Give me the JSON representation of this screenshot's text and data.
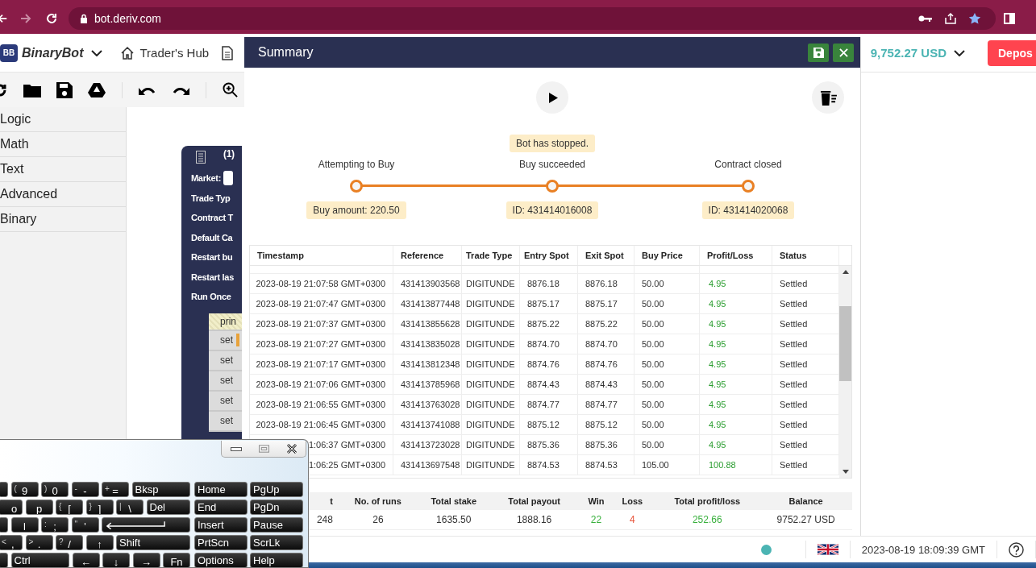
{
  "browser": {
    "url": "bot.deriv.com"
  },
  "header": {
    "logo": "BB",
    "app_name": "BinaryBot",
    "hub_link": "Trader's Hub",
    "balance": "9,752.27 USD",
    "deposit_button": "Depos"
  },
  "toolbox": [
    "Logic",
    "Math",
    "Text",
    "Advanced",
    "Binary"
  ],
  "workspace_block": {
    "count": "(1)",
    "fields": [
      "Market:",
      "Trade Typ",
      "Contract T",
      "Default Ca",
      "Restart bu",
      "Restart las",
      "Run Once"
    ],
    "statements": [
      {
        "kind": "print",
        "text": "prin",
        "has_variable": false
      },
      {
        "kind": "set",
        "text": "set",
        "has_variable": true
      },
      {
        "kind": "set",
        "text": "set",
        "has_variable": false
      },
      {
        "kind": "set",
        "text": "set",
        "has_variable": false
      },
      {
        "kind": "set",
        "text": "set",
        "has_variable": false
      },
      {
        "kind": "set",
        "text": "set",
        "has_variable": false
      }
    ]
  },
  "summary": {
    "title": "Summary",
    "status_message": "Bot has stopped.",
    "steps": [
      {
        "label": "Attempting to Buy",
        "info": "Buy amount: 220.50"
      },
      {
        "label": "Buy succeeded",
        "info": "ID: 431414016008"
      },
      {
        "label": "Contract closed",
        "info": "ID: 431414020068"
      }
    ],
    "table": {
      "columns": [
        "Timestamp",
        "Reference",
        "Trade Type",
        "Entry Spot",
        "Exit Spot",
        "Buy Price",
        "Profit/Loss",
        "Status"
      ],
      "rows": [
        [
          "2023-08-19 21:07:58 GMT+0300",
          "431413903568",
          "DIGITUNDE",
          "8876.18",
          "8876.18",
          "50.00",
          "4.95",
          "Settled"
        ],
        [
          "2023-08-19 21:07:47 GMT+0300",
          "431413877448",
          "DIGITUNDE",
          "8875.17",
          "8875.17",
          "50.00",
          "4.95",
          "Settled"
        ],
        [
          "2023-08-19 21:07:37 GMT+0300",
          "431413855628",
          "DIGITUNDE",
          "8875.22",
          "8875.22",
          "50.00",
          "4.95",
          "Settled"
        ],
        [
          "2023-08-19 21:07:27 GMT+0300",
          "431413835028",
          "DIGITUNDE",
          "8874.70",
          "8874.70",
          "50.00",
          "4.95",
          "Settled"
        ],
        [
          "2023-08-19 21:07:17 GMT+0300",
          "431413812348",
          "DIGITUNDE",
          "8874.76",
          "8874.76",
          "50.00",
          "4.95",
          "Settled"
        ],
        [
          "2023-08-19 21:07:06 GMT+0300",
          "431413785968",
          "DIGITUNDE",
          "8874.43",
          "8874.43",
          "50.00",
          "4.95",
          "Settled"
        ],
        [
          "2023-08-19 21:06:55 GMT+0300",
          "431413763028",
          "DIGITUNDE",
          "8874.77",
          "8874.77",
          "50.00",
          "4.95",
          "Settled"
        ],
        [
          "2023-08-19 21:06:45 GMT+0300",
          "431413741088",
          "DIGITUNDE",
          "8875.12",
          "8875.12",
          "50.00",
          "4.95",
          "Settled"
        ],
        [
          "1:06:37 GMT+0300",
          "431413723028",
          "DIGITUNDE",
          "8875.36",
          "8875.36",
          "50.00",
          "4.95",
          "Settled"
        ],
        [
          "1:06:25 GMT+0300",
          "431413697548",
          "DIGITUNDE",
          "8874.53",
          "8874.53",
          "105.00",
          "100.88",
          "Settled"
        ]
      ]
    },
    "stats": [
      {
        "label": "t",
        "value": "248",
        "color": "#333333"
      },
      {
        "label": "No. of runs",
        "value": "26",
        "color": "#333333"
      },
      {
        "label": "Total stake",
        "value": "1635.50",
        "color": "#333333"
      },
      {
        "label": "Total payout",
        "value": "1888.16",
        "color": "#333333"
      },
      {
        "label": "Win",
        "value": "22",
        "color": "#39b03d"
      },
      {
        "label": "Loss",
        "value": "4",
        "color": "#e8553b"
      },
      {
        "label": "Total profit/loss",
        "value": "252.66",
        "color": "#39b03d"
      },
      {
        "label": "Balance",
        "value": "9752.27 USD",
        "color": "#333333"
      }
    ]
  },
  "footer": {
    "online": true,
    "time": "2023-08-19 18:09:39 GMT"
  },
  "keyboard": {
    "rows": [
      {
        "main": [
          {
            "kind": "stub"
          },
          {
            "kind": "key",
            "shift": "(",
            "char": "9"
          },
          {
            "kind": "key",
            "shift": ")",
            "char": "0"
          },
          {
            "kind": "key",
            "shift": "-",
            "char": "-"
          },
          {
            "kind": "key",
            "shift": "+",
            "char": "="
          },
          {
            "kind": "wide",
            "char": "Bksp"
          }
        ],
        "nav": [
          "Home",
          "PgUp"
        ]
      },
      {
        "main": [
          {
            "kind": "half",
            "char": "o"
          },
          {
            "kind": "key",
            "char": "p"
          },
          {
            "kind": "key",
            "shift": "{",
            "char": "["
          },
          {
            "kind": "key",
            "shift": "}",
            "char": "]"
          },
          {
            "kind": "key",
            "shift": "|",
            "char": "\\"
          },
          {
            "kind": "wide",
            "char": "Del"
          }
        ],
        "nav": [
          "End",
          "PgDn"
        ]
      },
      {
        "main": [
          {
            "kind": "stub"
          },
          {
            "kind": "key",
            "char": "l"
          },
          {
            "kind": "key",
            "shift": ":",
            "char": ";"
          },
          {
            "kind": "key",
            "shift": "\"",
            "char": "'"
          },
          {
            "kind": "enter"
          }
        ],
        "nav": [
          "Insert",
          "Pause"
        ]
      },
      {
        "main": [
          {
            "kind": "half",
            "shift": "<",
            "char": ","
          },
          {
            "kind": "key",
            "shift": ">",
            "char": "."
          },
          {
            "kind": "key",
            "shift": "?",
            "char": "/"
          },
          {
            "kind": "key",
            "char": "↑"
          },
          {
            "kind": "wide",
            "char": "Shift"
          }
        ],
        "nav": [
          "PrtScn",
          "ScrLk"
        ]
      },
      {
        "main": [
          {
            "kind": "stub"
          },
          {
            "kind": "wide",
            "char": "Ctrl"
          },
          {
            "kind": "key",
            "char": "←"
          },
          {
            "kind": "key",
            "char": "↓"
          },
          {
            "kind": "key",
            "char": "→"
          },
          {
            "kind": "key",
            "char": "Fn"
          }
        ],
        "nav": [
          "Options",
          "Help"
        ]
      }
    ]
  }
}
